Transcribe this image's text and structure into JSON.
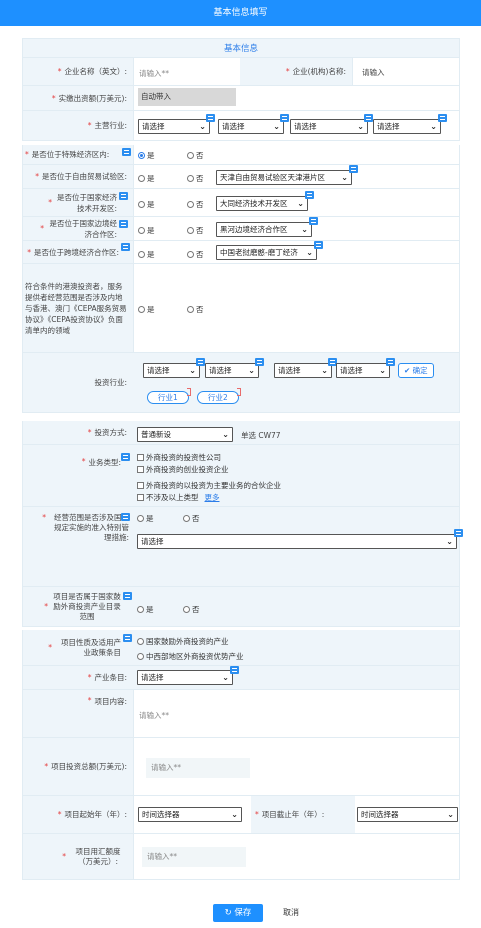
{
  "header": {
    "title": "基本信息填写"
  },
  "section": {
    "title": "基本信息"
  },
  "common": {
    "req": "*",
    "placeholder": "请输入**",
    "placeholder_plain": "请输入",
    "select": "请选择",
    "yes": "是",
    "no": "否"
  },
  "fields": {
    "company_en_label": "企业名称（英文）:",
    "company_cn_label": "企业(机构)名称:",
    "capital_label": "实缴出资额(万美元):",
    "capital_value": "自动带入",
    "industry_label": "主营行业:",
    "sez_label": "是否位于特殊经济区内:",
    "ftz_label": "是否位于自由贸易试验区:",
    "ftz_value": "天津自由贸易试验区天津港片区",
    "devzone_label": "是否位于国家经济技术开发区:",
    "devzone_value": "大同经济技术开发区",
    "border_label": "是否位于国家边境经济合作区:",
    "border_value": "黑河边境经济合作区",
    "crossborder_label": "是否位于跨境经济合作区:",
    "crossborder_value": "中国老挝磨憨-磨丁经济",
    "cepa_label": "符合条件的港澳投资者，服务提供者经营范围是否涉及内地与香港、澳门《CEPA服务贸易协议》《CEPA投资协议》负面清单内的领域",
    "invest_industry_label": "投资行业:",
    "confirm_label": "确定",
    "tag1": "行业1",
    "tag2": "行业2",
    "invest_method_label": "投资方式:",
    "invest_method_value": "普通新设",
    "invest_method_note": "单选 CW77",
    "biz_type_label": "业务类型:",
    "biz_options": [
      "外商投资的投资性公司",
      "外商投资的创业投资企业",
      "外商投资的以投资为主要业务的合伙企业",
      "不涉及以上类型"
    ],
    "more_link": "更多",
    "scope_label": "经营范围是否涉及国家规定实施的准入特别管理措施:",
    "encourage_label": "项目是否属于国家鼓励外商投资产业目录范围",
    "policy_label": "项目性质及适用产业政策条目",
    "policy_options": [
      "国家鼓励外商投资的产业",
      "中西部地区外商投资优势产业"
    ],
    "entry_label": "产业条目:",
    "content_label": "项目内容:",
    "total_label": "项目投资总额(万美元):",
    "start_label": "项目起始年（年）:",
    "end_label": "项目截止年（年）:",
    "time_picker": "时间选择器",
    "forex_label": "项目用汇额度（万美元）:"
  },
  "footer": {
    "save_label": "保存",
    "cancel_label": "取消"
  },
  "colors": {
    "primary": "#1e90ff",
    "row_bg": "#eef5fa",
    "required": "#e43d3d"
  }
}
